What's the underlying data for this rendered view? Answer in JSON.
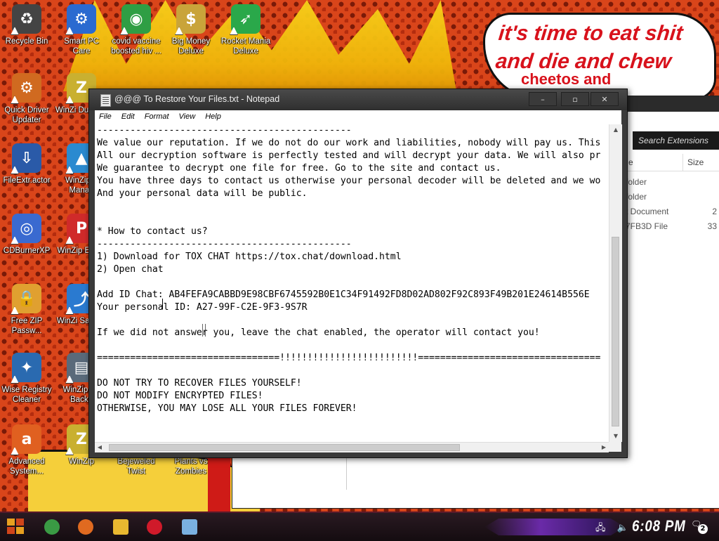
{
  "wallpaper": {
    "speech_line1": "it's time to eat shit",
    "speech_line2": "and die and chew",
    "speech_line3": "cheetos and"
  },
  "desktop_icons": [
    {
      "label": "Recycle Bin",
      "icon": "recycle-bin-icon",
      "color": "#444444"
    },
    {
      "label": "Smart PC Care",
      "icon": "pc-care-icon",
      "color": "#2a6ad0"
    },
    {
      "label": "covid vaccine boosted hiv ...",
      "icon": "chrome-icon",
      "color": "#2f9e44"
    },
    {
      "label": "Big Money Deluxe",
      "icon": "money-bag-icon",
      "color": "#c9a43a"
    },
    {
      "label": "Rocket Mania Deluxe",
      "icon": "rocket-icon",
      "color": "#2aa84a"
    },
    {
      "label": "Quick Driver Updater",
      "icon": "gear-icon",
      "color": "#d06a20"
    },
    {
      "label": "WinZi Duplicat",
      "icon": "winzip-icon",
      "color": "#c9b030"
    },
    {
      "label": "FileExtr.actor",
      "icon": "file-extractor-icon",
      "color": "#2a5aa8"
    },
    {
      "label": "WinZip Ir Manag",
      "icon": "image-manager-icon",
      "color": "#2a8ad0"
    },
    {
      "label": "CDBurnerXP",
      "icon": "cd-icon",
      "color": "#3a6ad0"
    },
    {
      "label": "WinZip Expre",
      "icon": "pdf-icon",
      "color": "#d02a2a"
    },
    {
      "label": "Free ZIP Passw...",
      "icon": "zip-lock-icon",
      "color": "#e0a030"
    },
    {
      "label": "WinZi SafeSh",
      "icon": "share-icon",
      "color": "#2a7ad0"
    },
    {
      "label": "Wise Registry Cleaner",
      "icon": "registry-icon",
      "color": "#2a6ab0"
    },
    {
      "label": "WinZip Se Backu",
      "icon": "server-icon",
      "color": "#5a6a7a"
    },
    {
      "label": "Advanced System...",
      "icon": "asc-icon",
      "color": "#e06020"
    },
    {
      "label": "WinZip",
      "icon": "winzip-icon",
      "color": "#c9b030"
    },
    {
      "label": "Bejeweled Twist",
      "icon": "gem-icon",
      "color": "#a040c0"
    },
    {
      "label": "Plants vs Zombies",
      "icon": "plant-icon",
      "color": "#40a040"
    }
  ],
  "explorer": {
    "search_placeholder": "Search Extensions",
    "col_name": "e",
    "col_size": "Size",
    "rows": [
      {
        "name": "folder",
        "size": ""
      },
      {
        "name": "folder",
        "size": ""
      },
      {
        "name": "t Document",
        "size": "2"
      },
      {
        "name": "7FB3D File",
        "size": "33"
      }
    ]
  },
  "notepad": {
    "title": "@@@ To Restore Your Files.txt - Notepad",
    "menu": [
      "File",
      "Edit",
      "Format",
      "View",
      "Help"
    ],
    "controls": {
      "minimize": "–",
      "maximize": "▫",
      "close": "✕"
    },
    "lines": [
      "----------------------------------------------",
      "We value our reputation. If we do not do our work and liabilities, nobody will pay us. This",
      "All our decryption software is perfectly tested and will decrypt your data. We will also pr",
      "We guarantee to decrypt one file for free. Go to the site and contact us.",
      "You have three days to contact us otherwise your personal decoder will be deleted and we wo",
      "And your personal data will be public.",
      "",
      "",
      "* How to contact us?",
      "----------------------------------------------",
      "1) Download for TOX CHAT https://tox.chat/download.html",
      "2) Open chat",
      "",
      "Add ID Chat: AB4FEFA9CABBD9E98CBF6745592B0E1C34F91492FD8D02AD802F92C893F49B201E24614B556E",
      "Your personal ID: A27-99F-C2E-9F3-9S7R",
      "",
      "If we did not answer you, leave the chat enabled, the operator will contact you!",
      "",
      "=================================!!!!!!!!!!!!!!!!!!!!!!!!!=================================",
      "",
      "DO NOT TRY TO RECOVER FILES YOURSELF!",
      "DO NOT MODIFY ENCRYPTED FILES!",
      "OTHERWISE, YOU MAY LOSE ALL YOUR FILES FOREVER!",
      "",
      "",
      "=========================================================================================="
    ]
  },
  "taskbar": {
    "apps": [
      {
        "name": "chrome",
        "icon": "chrome-icon",
        "color": "#3a9a44"
      },
      {
        "name": "firefox",
        "icon": "firefox-icon",
        "color": "#e06a20"
      },
      {
        "name": "file explorer",
        "icon": "folder-icon",
        "color": "#e8b830"
      },
      {
        "name": "opera",
        "icon": "opera-icon",
        "color": "#d01a2a"
      },
      {
        "name": "notepad",
        "icon": "notepad-icon",
        "color": "#7ab0e0"
      }
    ],
    "clock": "6:08 PM",
    "notifications": "2"
  }
}
